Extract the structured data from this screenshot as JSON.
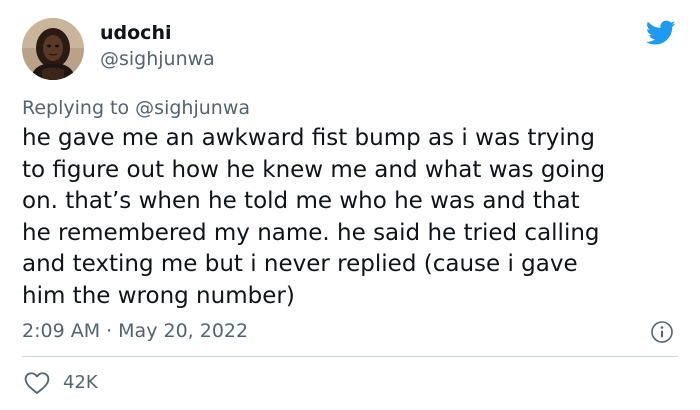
{
  "author": {
    "display_name": "udochi",
    "handle": "@sighjunwa",
    "avatar_icon": "profile-avatar"
  },
  "brand": {
    "logo_icon": "twitter-bird-icon",
    "color": "#1d9bf0"
  },
  "reply": {
    "prefix": "Replying to",
    "mention": "@sighjunwa"
  },
  "tweet": {
    "lines": [
      "he gave me an awkward fist bump as i was trying",
      "to figure out how he knew me and what was going",
      "on. that’s when he told me who he was and that",
      "he remembered my name. he said he tried calling",
      "and texting me but i never replied (cause i gave",
      "him the wrong number)"
    ]
  },
  "meta": {
    "time": "2:09 AM",
    "separator": "·",
    "date": "May 20, 2022",
    "info_icon": "info-icon"
  },
  "actions": {
    "like_icon": "heart-icon",
    "like_count": "42K"
  },
  "colors": {
    "text_primary": "#0f1419",
    "text_secondary": "#536471",
    "divider": "#cfd9de"
  }
}
